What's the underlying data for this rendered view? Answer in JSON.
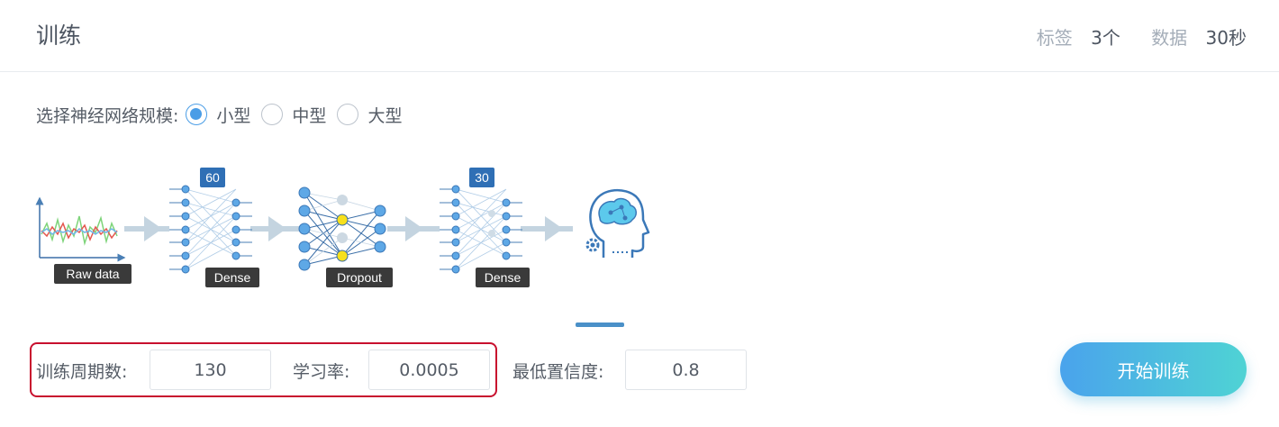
{
  "header": {
    "title": "训练",
    "stats": [
      {
        "label": "标签",
        "value": "3个"
      },
      {
        "label": "数据",
        "value": "30秒"
      }
    ]
  },
  "network_scale": {
    "label": "选择神经网络规模:",
    "options": [
      {
        "label": "小型",
        "selected": true
      },
      {
        "label": "中型",
        "selected": false
      },
      {
        "label": "大型",
        "selected": false
      }
    ]
  },
  "pipeline": {
    "raw_data_label": "Raw data",
    "dense1_label": "Dense",
    "dense1_units": "60",
    "dropout_label": "Dropout",
    "dense2_label": "Dense",
    "dense2_units": "30",
    "output_icon": "brain-head-icon"
  },
  "params": {
    "epochs_label": "训练周期数:",
    "epochs_value": "130",
    "learning_rate_label": "学习率:",
    "learning_rate_value": "0.0005",
    "min_confidence_label": "最低置信度:",
    "min_confidence_value": "0.8"
  },
  "actions": {
    "start_label": "开始训练"
  },
  "colors": {
    "accent": "#4a9de6",
    "highlight_border": "#c8102e",
    "button_gradient_start": "#4aa3ec",
    "button_gradient_end": "#4fd3d4",
    "node_blue": "#5ea8e6",
    "dropout_node": "#f7e01c"
  }
}
